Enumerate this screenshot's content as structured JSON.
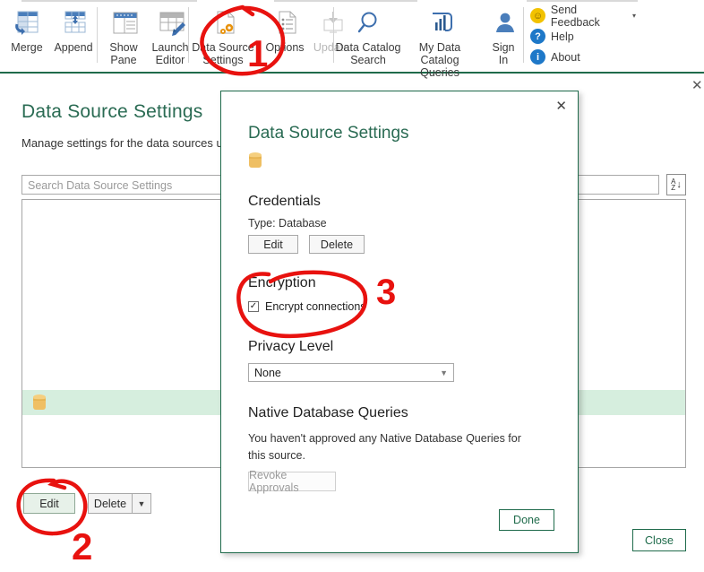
{
  "ribbon": {
    "buttons": [
      {
        "label": "Merge",
        "icon": "merge-table-icon",
        "enabled": true
      },
      {
        "label": "Append",
        "icon": "append-table-icon",
        "enabled": true
      },
      {
        "label": "Show\nPane",
        "label_l1": "Show",
        "label_l2": "Pane",
        "icon": "show-pane-icon",
        "enabled": true
      },
      {
        "label": "Launch\nEditor",
        "label_l1": "Launch",
        "label_l2": "Editor",
        "icon": "launch-editor-icon",
        "enabled": true
      },
      {
        "label": "Data Source\nSettings",
        "label_l1": "Data Source",
        "label_l2": "Settings",
        "icon": "data-source-settings-icon",
        "enabled": true
      },
      {
        "label": "Options",
        "label_l1": "Options",
        "label_l2": "",
        "icon": "options-icon",
        "enabled": true
      },
      {
        "label": "Update",
        "label_l1": "Update",
        "label_l2": "",
        "icon": "update-icon",
        "enabled": false
      },
      {
        "label": "Data Catalog\nSearch",
        "label_l1": "Data Catalog",
        "label_l2": "Search",
        "icon": "search-magnifier-icon",
        "enabled": true
      },
      {
        "label": "My Data\nCatalog Queries",
        "label_l1": "My Data",
        "label_l2": "Catalog Queries",
        "icon": "power-bi-bars-icon",
        "enabled": true
      },
      {
        "label": "Sign\nIn",
        "label_l1": "Sign",
        "label_l2": "In",
        "icon": "person-icon",
        "enabled": true
      }
    ],
    "links": [
      {
        "label": "Send Feedback",
        "icon": "smiley-face-icon",
        "color": "#f2c200",
        "glyph": "☺",
        "has_caret": true
      },
      {
        "label": "Help",
        "icon": "question-mark-icon",
        "color": "#1e78c8",
        "glyph": "?",
        "has_caret": false
      },
      {
        "label": "About",
        "icon": "info-icon",
        "color": "#1e78c8",
        "glyph": "i",
        "has_caret": false
      }
    ]
  },
  "page": {
    "title": "Data Source Settings",
    "subtitle": "Manage settings for the data sources u",
    "search_placeholder": "Search Data Source Settings",
    "sort_icon": "sort-a-to-z-icon",
    "sort_az_top": "A",
    "sort_az_bottom": "Z",
    "sort_arrow": "↓",
    "selected_row_icon": "database-cylinder-icon",
    "selected_row_label": "",
    "edit_label": "Edit",
    "delete_label": "Delete",
    "delete_caret": "▼",
    "close_label": "Close",
    "window_close_icon": "close-x-icon",
    "window_close_glyph": "✕"
  },
  "modal": {
    "close_icon": "close-x-icon",
    "close_glyph": "✕",
    "title": "Data Source Settings",
    "source_icon": "database-cylinder-icon",
    "credentials": {
      "heading": "Credentials",
      "type_text": "Type: Database",
      "edit_label": "Edit",
      "delete_label": "Delete"
    },
    "encryption": {
      "heading": "Encryption",
      "checkbox_label": "Encrypt connections",
      "checked": true,
      "check_glyph": "✓"
    },
    "privacy": {
      "heading": "Privacy Level",
      "selected": "None",
      "caret": "▼",
      "options": [
        "None"
      ]
    },
    "native_queries": {
      "heading": "Native Database Queries",
      "body": "You haven't approved any Native Database Queries for this source.",
      "revoke_label": "Revoke Approvals"
    },
    "done_label": "Done"
  },
  "annotations": {
    "color": "#e8120f",
    "marks": [
      {
        "id": "1",
        "label": "1",
        "target": "data-source-settings-ribbon-button"
      },
      {
        "id": "2",
        "label": "2",
        "target": "edit-button"
      },
      {
        "id": "3",
        "label": "3",
        "target": "encryption-section"
      }
    ]
  },
  "colors": {
    "accent_green": "#1f6b4b",
    "title_green": "#2a6b53",
    "selection_green": "#d6eede",
    "annotation_red": "#e8120f",
    "db_icon_gold": "#efbf63",
    "ribbon_blue": "#4a7ebb"
  }
}
